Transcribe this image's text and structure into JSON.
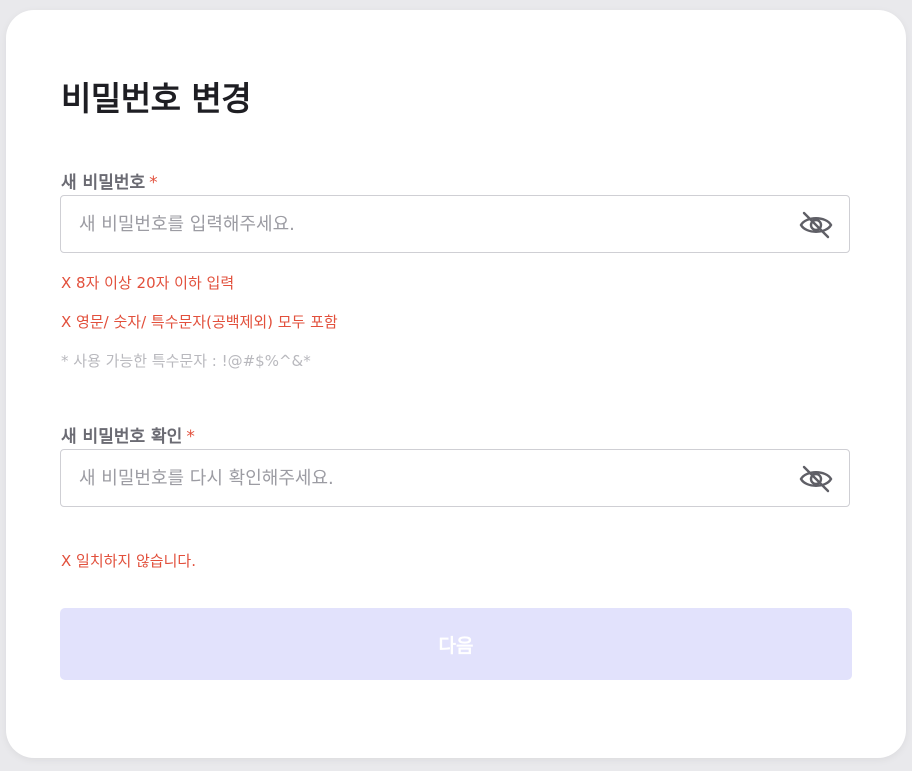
{
  "page": {
    "title": "비밀번호 변경"
  },
  "new_password": {
    "label": "새 비밀번호",
    "required_mark": "*",
    "placeholder": "새 비밀번호를 입력해주세요.",
    "value": "",
    "visibility_icon": "eye-off-icon",
    "rules": [
      {
        "text": "X 8자 이상 20자 이하 입력",
        "status": "error"
      },
      {
        "text": "X 영문/ 숫자/ 특수문자(공백제외) 모두 포함",
        "status": "error"
      }
    ],
    "hint": "* 사용 가능한 특수문자 : !@#$%^&*"
  },
  "confirm_password": {
    "label": "새 비밀번호 확인",
    "required_mark": "*",
    "placeholder": "새 비밀번호를 다시 확인해주세요.",
    "value": "",
    "visibility_icon": "eye-off-icon",
    "error": "X 일치하지 않습니다."
  },
  "next_button": {
    "label": "다음",
    "enabled": false
  },
  "colors": {
    "error": "#e2503c",
    "hint": "#b9b9be",
    "button_disabled_bg": "#e2e2fc",
    "label": "#6b6b73",
    "title": "#1e1e23"
  }
}
